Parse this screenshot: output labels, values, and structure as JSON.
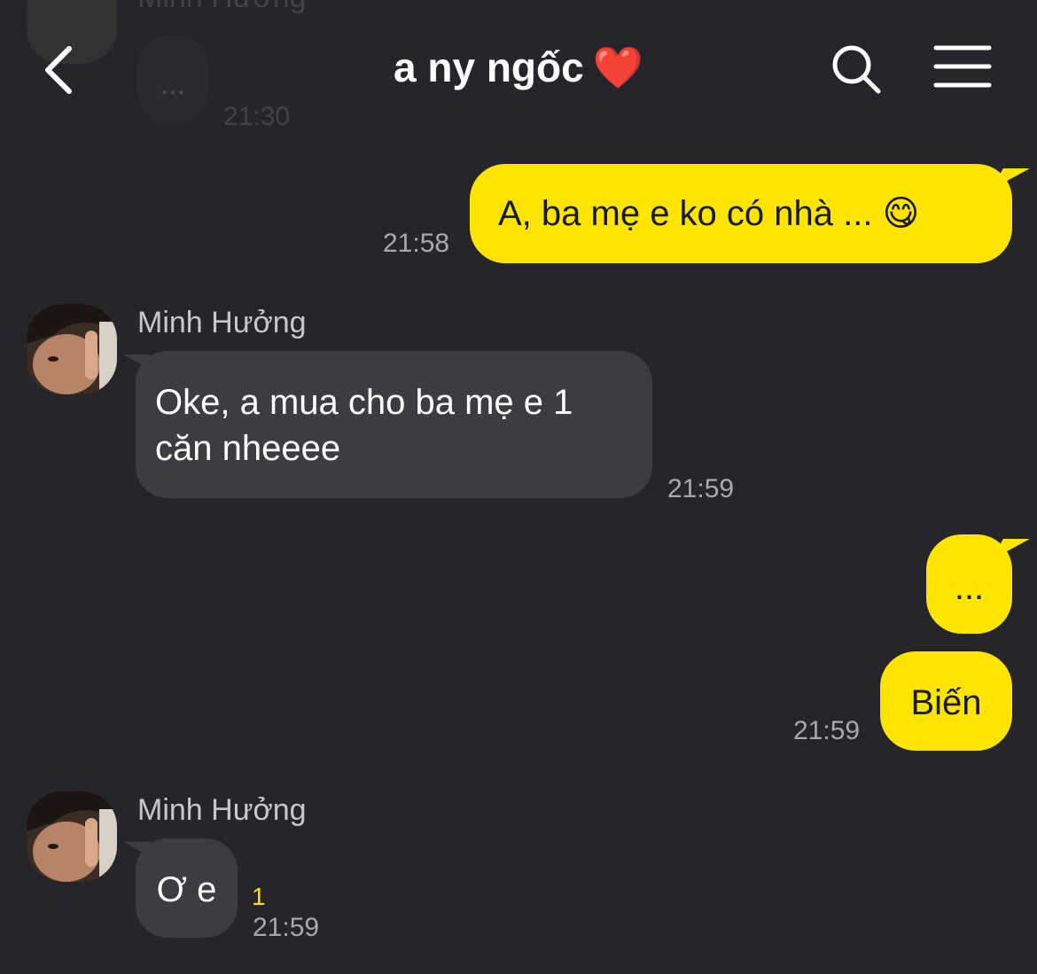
{
  "header": {
    "title": "a ny ngốc",
    "title_emoji": "❤️"
  },
  "ghost": {
    "sender": "Minh Hưởng",
    "text": "...",
    "time": "21:30"
  },
  "messages": [
    {
      "id": "m1",
      "direction": "outgoing",
      "text": "A, ba mẹ e ko có nhà ... 😋",
      "time": "21:58"
    },
    {
      "id": "m2",
      "direction": "incoming",
      "sender": "Minh Hưởng",
      "text_line1": "Oke, a mua cho ba mẹ e 1",
      "text_line2": "căn nheeee",
      "time": "21:59"
    },
    {
      "id": "m3",
      "direction": "outgoing",
      "text": "..."
    },
    {
      "id": "m4",
      "direction": "outgoing",
      "text": "Biến",
      "time": "21:59"
    },
    {
      "id": "m5",
      "direction": "incoming",
      "sender": "Minh Hưởng",
      "text": "Ơ e",
      "unread": "1",
      "time": "21:59"
    }
  ],
  "colors": {
    "background": "#26262a",
    "outgoing_bubble": "#fee500",
    "incoming_bubble": "#3d3d41"
  },
  "icons": {
    "back": "chevron-left-icon",
    "search": "search-icon",
    "menu": "menu-icon"
  }
}
